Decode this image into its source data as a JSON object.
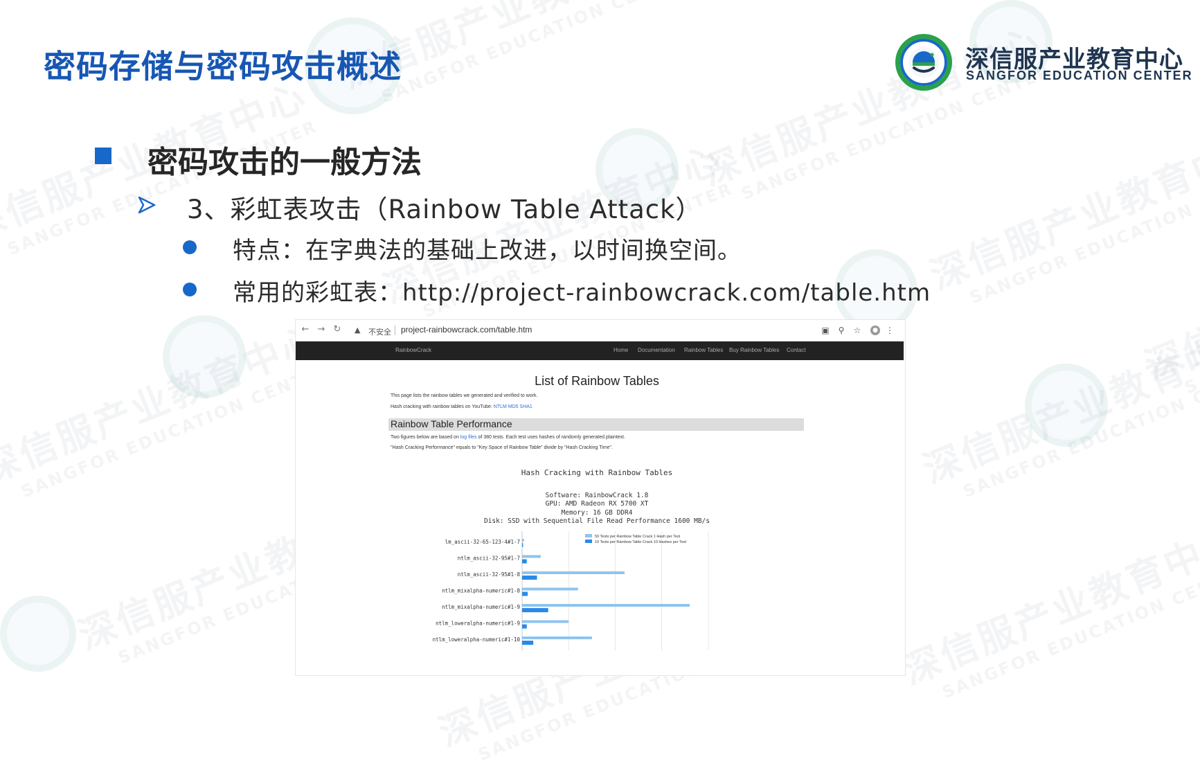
{
  "slide": {
    "title": "密码存储与密码攻击概述",
    "section_heading": "密码攻击的一般方法",
    "sub_heading": "3、彩虹表攻击（Rainbow Table Attack）",
    "bullets": [
      "特点：在字典法的基础上改进，以时间换空间。",
      "常用的彩虹表：http://project-rainbowcrack.com/table.htm"
    ],
    "accent_color": "#1768c9",
    "title_color": "#1757b3"
  },
  "logo": {
    "name_cn": "深信服产业教育中心",
    "name_en": "SANGFOR EDUCATION CENTER",
    "badge_top": "EDUCATION CENTER",
    "badge_left": "SANGFOR",
    "badge_bottom": "深信服产业教育中心",
    "icon": "sangfor-badge-icon"
  },
  "watermark": {
    "text_cn": "深信服产业教育中心",
    "text_en": "SANGFOR EDUCATION CENTER"
  },
  "browser": {
    "insecure_label": "不安全",
    "url": "project-rainbowcrack.com/table.htm",
    "icons": [
      "back-icon",
      "forward-icon",
      "reload-icon",
      "warning-icon",
      "translate-icon",
      "zoom-icon",
      "star-icon",
      "profile-icon",
      "menu-icon"
    ],
    "site_brand": "RainbowCrack",
    "nav_links": [
      "Home",
      "Documentation",
      "Rainbow Tables",
      "Buy Rainbow Tables",
      "Contact"
    ],
    "page_title": "List of Rainbow Tables",
    "intro_1": "This page lists the rainbow tables we generated and verified to work.",
    "intro_2_prefix": "Hash cracking with rainbow tables on YouTube:",
    "intro_2_links": "NTLM MD5 SHA1",
    "section_title": "Rainbow Table Performance",
    "perf_1_prefix": "Two figures below are based on",
    "perf_1_link": "log files",
    "perf_1_suffix": "of 380 tests. Each test uses hashes of randomly generated plaintext.",
    "perf_2": "\"Hash Cracking Performance\" equals to \"Key Space of Rainbow Table\" divide by \"Hash Cracking Time\"."
  },
  "chart_data": {
    "type": "bar",
    "title": "Hash Cracking with Rainbow Tables",
    "specs": [
      "Software: RainbowCrack 1.8",
      "GPU: AMD Radeon RX 5700 XT",
      "Memory: 16 GB DDR4",
      "Disk: SSD with Sequential File Read Performance 1600 MB/s"
    ],
    "categories": [
      "lm_ascii-32-65-123-4#1-7",
      "ntlm_ascii-32-95#1-7",
      "ntlm_ascii-32-95#1-8",
      "ntlm_mixalpha-numeric#1-8",
      "ntlm_mixalpha-numeric#1-9",
      "ntlm_loweralpha-numeric#1-9",
      "ntlm_loweralpha-numeric#1-10"
    ],
    "series": [
      {
        "name": "50 Tests per Rainbow Table Crack 1 Hash per Test",
        "color": "#8fc4ee",
        "values": [
          0.02,
          0.2,
          1.1,
          0.6,
          1.8,
          0.5,
          0.75
        ]
      },
      {
        "name": "10 Tests per Rainbow Table Crack 10 Hashes per Test",
        "color": "#2b8ae6",
        "values": [
          0.01,
          0.05,
          0.16,
          0.06,
          0.28,
          0.05,
          0.12
        ]
      }
    ],
    "legend": "top-right",
    "grid": true
  }
}
